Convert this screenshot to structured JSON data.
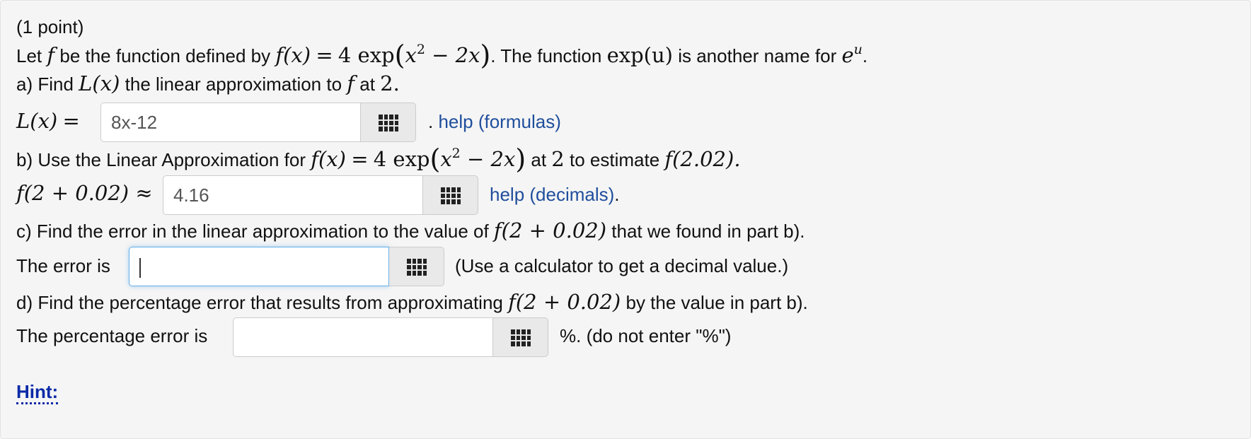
{
  "points": "(1 point)",
  "intro": {
    "prefix": "Let",
    "f": "f",
    "middle": "be the function defined by",
    "fx": "f(x)",
    "eq": "=",
    "four_exp": "4 exp",
    "lparen": "(",
    "x": "x",
    "sq": "2",
    "minus2x": " − 2x",
    "rparen": ")",
    "dot_text": ". The function",
    "expu": "exp(u)",
    "another": "is another name for",
    "e": "e",
    "u": "u",
    "period": "."
  },
  "part_a": {
    "prefix": "a) Find",
    "Lx": "L(x)",
    "middle": "the linear approximation to",
    "f": "f",
    "at": "at",
    "two": "2.",
    "label_Lx": "L(x)",
    "label_eq": "=",
    "answer_value": "8x-12",
    "help_dot": ". ",
    "help_text": "help (formulas)"
  },
  "part_b": {
    "prefix": "b) Use the Linear Approximation for",
    "fx": "f(x)",
    "eq": "=",
    "four_exp": "4 exp",
    "lparen": "(",
    "x": "x",
    "sq": "2",
    "minus2x": " − 2x",
    "rparen": ")",
    "at": "at",
    "two": "2",
    "to_estimate": "to estimate",
    "f202": "f(2.02).",
    "label": "f(2 + 0.02) ≈",
    "answer_value": "4.16",
    "help_text": "help (decimals)",
    "help_period": "."
  },
  "part_c": {
    "prefix": "c) Find the error in the linear approximation to the value of",
    "expr": "f(2 + 0.02)",
    "suffix": "that we found in part b).",
    "label": "The error is",
    "answer_value": "",
    "note": "(Use a calculator to get a decimal value.)"
  },
  "part_d": {
    "prefix": "d) Find the percentage error that results from approximating",
    "expr": "f(2 + 0.02)",
    "suffix": "by the value in part b).",
    "label": "The percentage error is",
    "answer_value": "",
    "note": "%. (do not enter \"%\")"
  },
  "hint": "Hint:",
  "icons": {
    "keyboard": "equation-editor-grid-icon"
  },
  "colors": {
    "link": "#1f4e9c",
    "hint": "#0b2aa8",
    "focus": "#66afe9",
    "panel": "#f5f5f5"
  }
}
